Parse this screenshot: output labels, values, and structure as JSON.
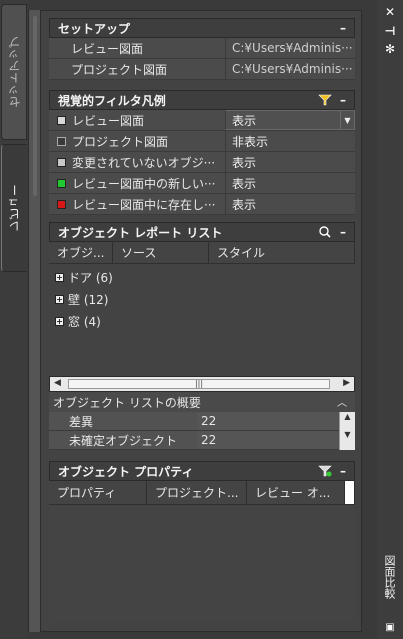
{
  "tabs": {
    "setup": "セットアップ",
    "review": "レビュー"
  },
  "right_panel": {
    "close": "✕",
    "pin": "⊣",
    "settings": "✻",
    "compare_label": "図面比較"
  },
  "setup_section": {
    "title": "セットアップ",
    "rows": [
      {
        "label": "レビュー図面",
        "value": "C:¥Users¥Adminis···"
      },
      {
        "label": "プロジェクト図面",
        "value": "C:¥Users¥Adminis···"
      }
    ]
  },
  "legend_section": {
    "title": "視覚的フィルタ凡例",
    "rows": [
      {
        "label": "レビュー図面",
        "value": "表示",
        "color": "#d8d8d8",
        "dropdown": true
      },
      {
        "label": "プロジェクト図面",
        "value": "非表示",
        "color": "#3a3a3a"
      },
      {
        "label": "変更されていないオブジ···",
        "value": "表示",
        "color": "#c8c8c8"
      },
      {
        "label": "レビュー図面中の新しい···",
        "value": "表示",
        "color": "#22c832"
      },
      {
        "label": "レビュー図面中に存在し···",
        "value": "表示",
        "color": "#d81818"
      }
    ]
  },
  "report_section": {
    "title": "オブジェクト レポート リスト",
    "columns": [
      "オブジ...",
      "ソース",
      "スタイル"
    ],
    "items": [
      "ドア (6)",
      "壁 (12)",
      "窓 (4)"
    ],
    "scroll_mid": "|||"
  },
  "summary_section": {
    "title": "オブジェクト リストの概要",
    "rows": [
      {
        "label": "差異",
        "value": "22"
      },
      {
        "label": "未確定オブジェクト",
        "value": "22"
      }
    ]
  },
  "props_section": {
    "title": "オブジェクト プロパティ",
    "columns": [
      "プロパティ",
      "プロジェクト...",
      "レビュー オ..."
    ]
  }
}
